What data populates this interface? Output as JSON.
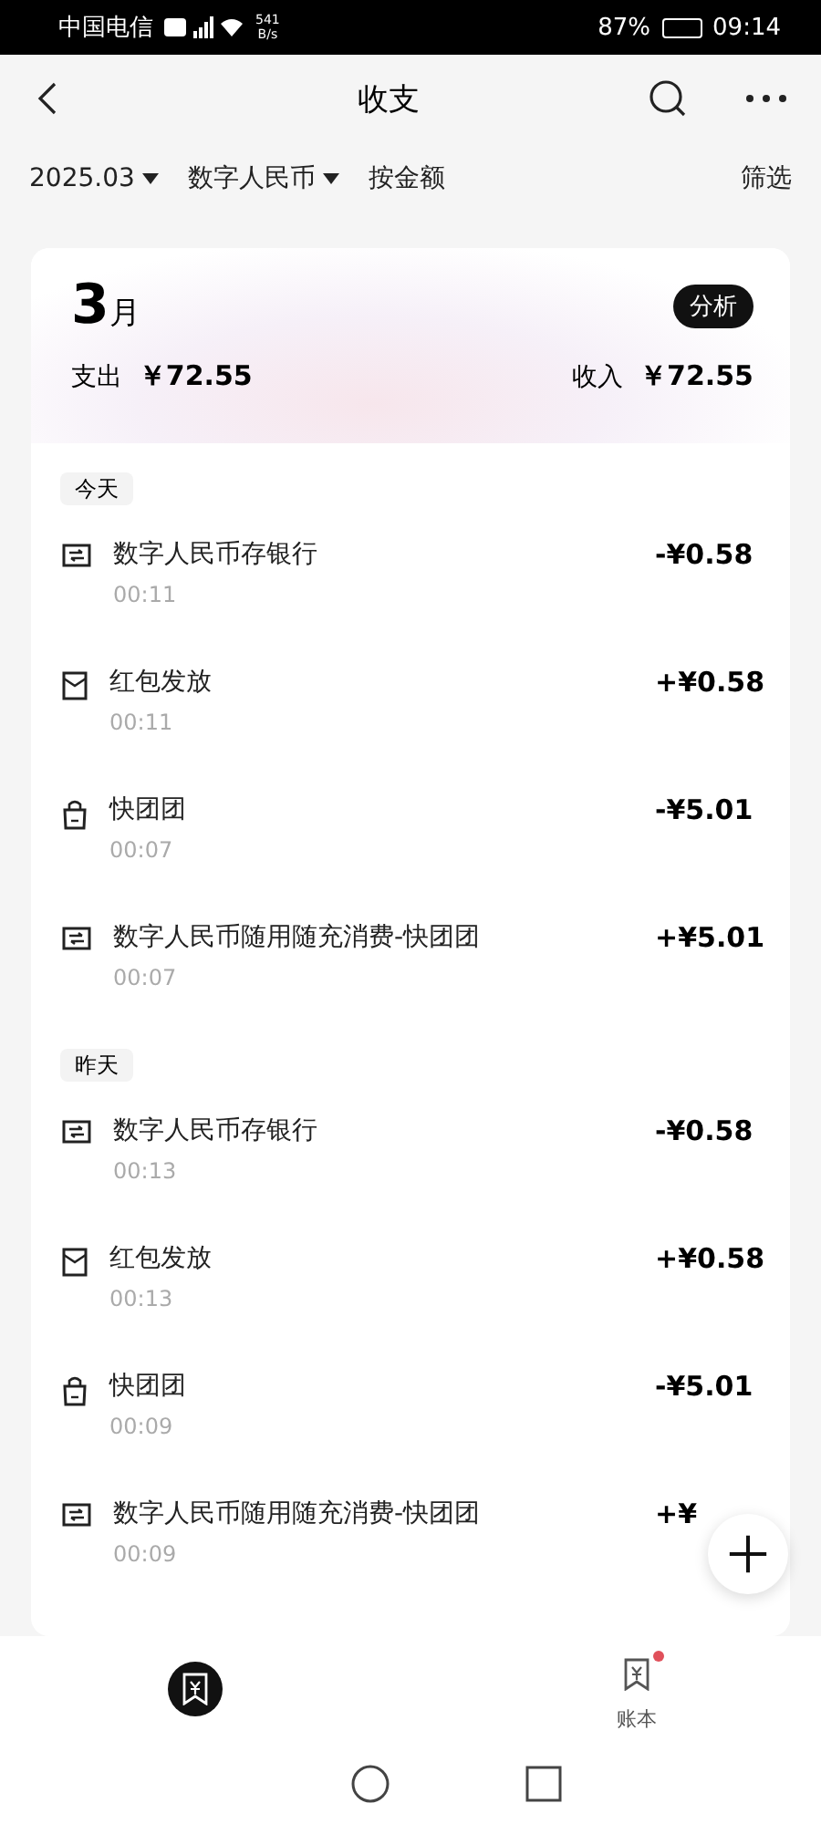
{
  "status_bar": {
    "carrier": "中国电信",
    "speed": "541",
    "speed_unit": "B/s",
    "battery_text": "87%",
    "time": "09:14"
  },
  "header": {
    "title": "收支"
  },
  "filters": [
    {
      "label": "2025.03",
      "dropdown": true
    },
    {
      "label": "数字人民币",
      "dropdown": true
    },
    {
      "label": "按金额",
      "dropdown": false
    }
  ],
  "filter_button": "筛选",
  "summary": {
    "month_number": "3",
    "month_unit": "月",
    "analyze_button": "分析",
    "expense_label": "支出",
    "expense": "￥72.55",
    "income_label": "收入",
    "income": "￥72.55"
  },
  "groups": [
    {
      "day": "今天",
      "transactions": [
        {
          "kind": "transfer",
          "title": "数字人民币存银行",
          "time": "00:11",
          "amount": "-¥0.58"
        },
        {
          "kind": "envelope",
          "title": "红包发放",
          "time": "00:11",
          "amount": "+¥0.58"
        },
        {
          "kind": "bag",
          "title": "快团团",
          "time": "00:07",
          "amount": "-¥5.01"
        },
        {
          "kind": "transfer",
          "title": "数字人民币随用随充消费-快团团",
          "time": "00:07",
          "amount": "+¥5.01"
        }
      ]
    },
    {
      "day": "昨天",
      "transactions": [
        {
          "kind": "transfer",
          "title": "数字人民币存银行",
          "time": "00:13",
          "amount": "-¥0.58"
        },
        {
          "kind": "envelope",
          "title": "红包发放",
          "time": "00:13",
          "amount": "+¥0.58"
        },
        {
          "kind": "bag",
          "title": "快团团",
          "time": "00:09",
          "amount": "-¥5.01"
        },
        {
          "kind": "transfer",
          "title": "数字人民币随用随充消费-快团团",
          "time": "00:09",
          "amount": "+¥"
        }
      ]
    }
  ],
  "bottom_nav": [
    {
      "selected": true,
      "badge": false
    },
    {
      "label": "账本",
      "selected": false,
      "badge": true
    }
  ]
}
